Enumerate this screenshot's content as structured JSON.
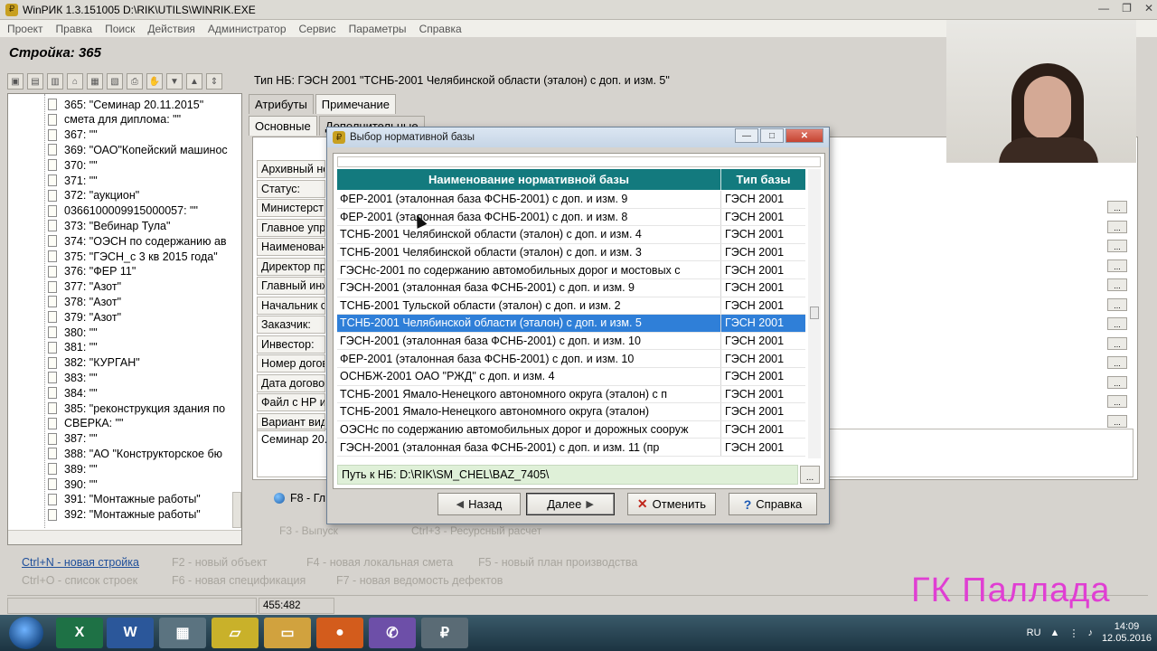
{
  "window": {
    "title": "WinPИК 1.3.151005   D:\\RIK\\UTILS\\WINRIK.EXE",
    "controls": [
      "—",
      "❐",
      "✕"
    ]
  },
  "menu": [
    "Проект",
    "Правка",
    "Поиск",
    "Действия",
    "Администратор",
    "Сервис",
    "Параметры",
    "Справка"
  ],
  "object_title": "Стройка: 365",
  "tree": {
    "items": [
      "365: \"Семинар 20.11.2015\"",
      "смета для диплома: \"\"",
      "367: \"\"",
      "369: \"ОАО\"Копейский машинос",
      "370: \"\"",
      "371: \"\"",
      "372: \"аукцион\"",
      "0366100009915000057: \"\"",
      "373: \"Вебинар Тула\"",
      "374: \"ОЭСН по содержанию ав",
      "375: \"ГЭСН_с 3 кв 2015 года\"",
      "376: \"ФЕР 11\"",
      "377: \"Азот\"",
      "378: \"Азот\"",
      "379: \"Азот\"",
      "380: \"\"",
      "381: \"\"",
      "382: \"КУРГАН\"",
      "383: \"\"",
      "384: \"\"",
      "385: \"реконструкция здания по",
      "СВЕРКА: \"\"",
      "387: \"\"",
      "388: \"АО \"Конструкторское бю",
      "389: \"\"",
      "390: \"\"",
      "391: \"Монтажные работы\"",
      "392: \"Монтажные работы\""
    ]
  },
  "right": {
    "header": "Тип НБ: ГЭСН 2001 \"ТСНБ-2001 Челябинской области (эталон) с доп. и изм. 5\"",
    "tabs": [
      "Атрибуты",
      "Примечание"
    ],
    "subtabs": [
      "Основные",
      "Дополнительные"
    ],
    "form_labels": [
      "Архивный но",
      "Статус:",
      "Министерст",
      "Главное упр",
      "Наименован",
      "Директор пр",
      "Главный инж",
      "Начальник с",
      "Заказчик:",
      "Инвестор:",
      "Номер догов",
      "Дата догово",
      "Файл с НР и",
      "Вариант вид"
    ],
    "comment": "Семинар 20.1",
    "f8_label": "F8 - Гл",
    "ghost_f3": "F3 - Выпуск",
    "ghost_ctrl": "Ctrl+3 - Ресурсный расчет"
  },
  "hotkeys": {
    "row1": [
      "Ctrl+N - новая стройка",
      "F2 - новый объект",
      "F4 - новая локальная смета",
      "F5 - новый план производства"
    ],
    "row2": [
      "Ctrl+O - список строек",
      "F6 - новая спецификация",
      "F7 - новая ведомость дефектов"
    ]
  },
  "status": {
    "coords": "455:482"
  },
  "dialog": {
    "title": "Выбор нормативной базы",
    "columns": [
      "Наименование нормативной базы",
      "Тип базы"
    ],
    "rows": [
      {
        "name": "ФЕР-2001 (эталонная база ФСНБ-2001) с доп. и изм. 9",
        "type": "ГЭСН 2001"
      },
      {
        "name": "ФЕР-2001 (эталонная база ФСНБ-2001) с доп. и изм. 8",
        "type": "ГЭСН 2001"
      },
      {
        "name": "ТСНБ-2001 Челябинской области (эталон) с доп. и изм. 4",
        "type": "ГЭСН 2001"
      },
      {
        "name": "ТСНБ-2001 Челябинской области (эталон) с доп. и изм. 3",
        "type": "ГЭСН 2001"
      },
      {
        "name": "ГЭСНс-2001 по содержанию автомобильных дорог и мостовых с",
        "type": "ГЭСН 2001"
      },
      {
        "name": "ГЭСН-2001 (эталонная база ФСНБ-2001) с доп. и изм. 9",
        "type": "ГЭСН 2001"
      },
      {
        "name": "ТСНБ-2001 Тульской области (эталон) с доп. и изм. 2",
        "type": "ГЭСН 2001"
      },
      {
        "name": "ТСНБ-2001 Челябинской области (эталон) с доп. и изм. 5",
        "type": "ГЭСН 2001"
      },
      {
        "name": "ГЭСН-2001 (эталонная база ФСНБ-2001) с доп. и изм. 10",
        "type": "ГЭСН 2001"
      },
      {
        "name": "ФЕР-2001 (эталонная база ФСНБ-2001) с доп. и изм. 10",
        "type": "ГЭСН 2001"
      },
      {
        "name": "ОСНБЖ-2001 ОАО \"РЖД\" с доп. и изм. 4",
        "type": "ГЭСН 2001"
      },
      {
        "name": "ТСНБ-2001 Ямало-Ненецкого автономного округа (эталон) с п",
        "type": "ГЭСН 2001"
      },
      {
        "name": "ТСНБ-2001 Ямало-Ненецкого автономного округа (эталон)",
        "type": "ГЭСН 2001"
      },
      {
        "name": "ОЭСНс по содержанию автомобильных дорог и дорожных сооруж",
        "type": "ГЭСН 2001"
      },
      {
        "name": "ГЭСН-2001 (эталонная база ФСНБ-2001) с доп. и изм. 11 (пр",
        "type": "ГЭСН 2001"
      }
    ],
    "selected_row": "ТСНБ-2001 Челябинской области (эталон) с доп. и изм. 5",
    "path": "Путь к НБ: D:\\RIK\\SM_CHEL\\BAZ_7405\\",
    "buttons": {
      "back": "Назад",
      "next": "Далее",
      "cancel": "Отменить",
      "help": "Справка"
    },
    "dots": "..."
  },
  "watermark": "ГК Паллада",
  "taskbar": {
    "lang": "RU",
    "time": "14:09",
    "date": "12.05.2016",
    "apps": [
      "excel-app",
      "word-app",
      "calculator-app",
      "sticky-app",
      "explorer-app",
      "firefox-app",
      "viber-app",
      "winrik-app"
    ]
  }
}
